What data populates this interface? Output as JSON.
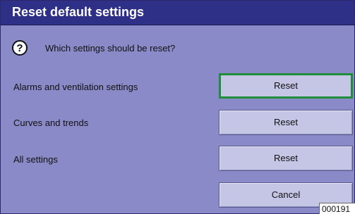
{
  "dialog": {
    "title": "Reset default settings",
    "question_icon": "question-mark-icon",
    "question_icon_glyph": "?",
    "question": "Which settings should be reset?",
    "rows": [
      {
        "label": "Alarms and ventilation settings",
        "button": "Reset",
        "selected": true
      },
      {
        "label": "Curves and trends",
        "button": "Reset",
        "selected": false
      },
      {
        "label": "All settings",
        "button": "Reset",
        "selected": false
      }
    ],
    "cancel": "Cancel"
  },
  "figure_code": "000191",
  "colors": {
    "titlebar": "#2e2f86",
    "background": "#8a8ac8",
    "button": "#c5c5e6",
    "selected_border": "#1e8e3a"
  }
}
